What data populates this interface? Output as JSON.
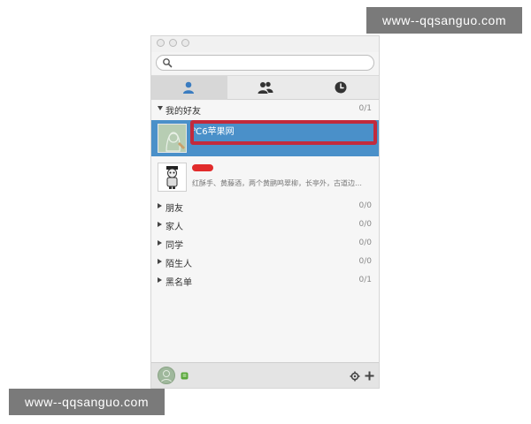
{
  "watermarks": {
    "top": "www--qqsanguo.com",
    "bottom": "www--qqsanguo.com"
  },
  "search": {
    "placeholder": "",
    "value": ""
  },
  "tabs": [
    {
      "icon": "person-icon",
      "active": true
    },
    {
      "icon": "group-icon",
      "active": false
    },
    {
      "icon": "clock-icon",
      "active": false
    }
  ],
  "groups": {
    "my_friends": {
      "name": "我的好友",
      "count": "0/1"
    },
    "others": [
      {
        "name": "朋友",
        "count": "0/0"
      },
      {
        "name": "家人",
        "count": "0/0"
      },
      {
        "name": "同学",
        "count": "0/0"
      },
      {
        "name": "陌生人",
        "count": "0/0"
      },
      {
        "name": "黑名单",
        "count": "0/1"
      }
    ]
  },
  "contacts": {
    "selected": {
      "name": "℃6苹果网"
    },
    "second": {
      "signature": "红酥手、黄藤酒，两个黄鹂鸣翠柳，长亭外，古道边…"
    }
  },
  "colors": {
    "selection": "#4a90c9",
    "highlight_border": "#c22a3c",
    "watermark_bg": "#7a7a7a"
  }
}
